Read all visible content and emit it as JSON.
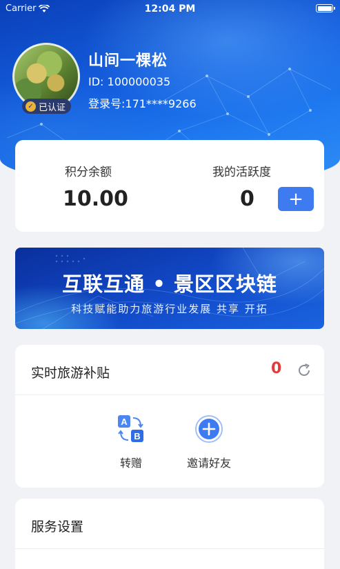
{
  "status_bar": {
    "carrier": "Carrier",
    "time": "12:04 PM"
  },
  "profile": {
    "name": "山间一棵松",
    "id_text": "ID: 100000035",
    "login_text": "登录号:171****9266",
    "verified_label": "已认证"
  },
  "points": {
    "balance_label": "积分余额",
    "balance_value": "10.00",
    "activity_label": "我的活跃度",
    "activity_value": "0",
    "add_label": "+"
  },
  "banner": {
    "title": "互联互通 • 景区区块链",
    "subtitle": "科技赋能助力旅游行业发展 共享 开拓"
  },
  "subsidy": {
    "title": "实时旅游补贴",
    "value": "0",
    "actions": [
      {
        "label": "转赠",
        "icon": "transfer-ab-icon"
      },
      {
        "label": "邀请好友",
        "icon": "invite-plus-icon"
      }
    ]
  },
  "service": {
    "title": "服务设置"
  },
  "colors": {
    "accent": "#3e7bf0",
    "alert": "#e53a3a",
    "header": "#1560e0"
  }
}
